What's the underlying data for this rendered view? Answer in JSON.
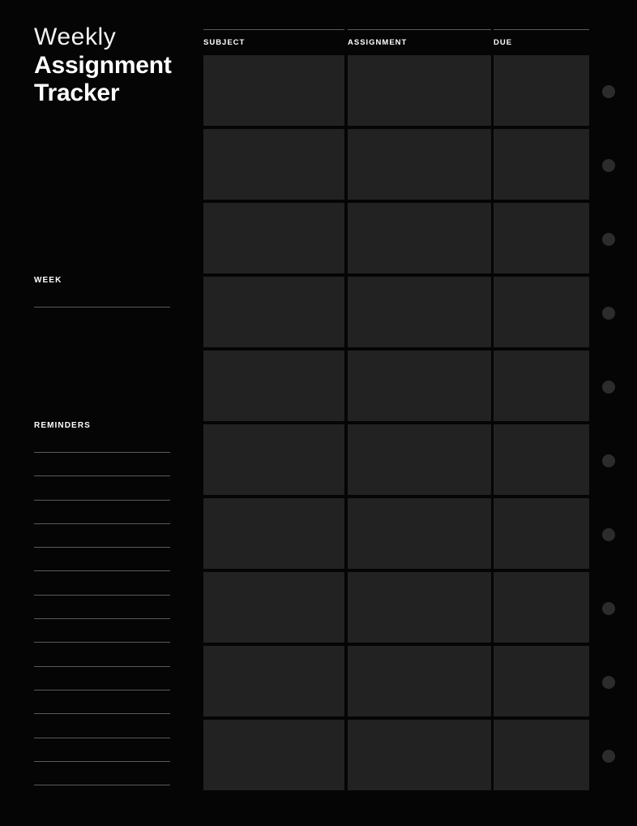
{
  "page": {
    "background_color": "#050505",
    "cell_color": "#222222",
    "rule_color": "#5a5a5a",
    "hole_color": "#2c2c2c",
    "text_color": "#ffffff"
  },
  "header": {
    "title_line_1": "Weekly",
    "title_line_2": "Assignment",
    "title_line_3": "Tracker"
  },
  "sidebar": {
    "week": {
      "label": "WEEK",
      "lines": 1
    },
    "reminders": {
      "label": "REMINDERS",
      "lines": 15
    }
  },
  "table": {
    "columns": [
      {
        "label": "SUBJECT",
        "key": "subject"
      },
      {
        "label": "ASSIGNMENT",
        "key": "assignment"
      },
      {
        "label": "DUE",
        "key": "due"
      }
    ],
    "rows": [
      {
        "subject": "",
        "assignment": "",
        "due": ""
      },
      {
        "subject": "",
        "assignment": "",
        "due": ""
      },
      {
        "subject": "",
        "assignment": "",
        "due": ""
      },
      {
        "subject": "",
        "assignment": "",
        "due": ""
      },
      {
        "subject": "",
        "assignment": "",
        "due": ""
      },
      {
        "subject": "",
        "assignment": "",
        "due": ""
      },
      {
        "subject": "",
        "assignment": "",
        "due": ""
      },
      {
        "subject": "",
        "assignment": "",
        "due": ""
      },
      {
        "subject": "",
        "assignment": "",
        "due": ""
      },
      {
        "subject": "",
        "assignment": "",
        "due": ""
      }
    ]
  },
  "binder": {
    "hole_count": 10
  }
}
